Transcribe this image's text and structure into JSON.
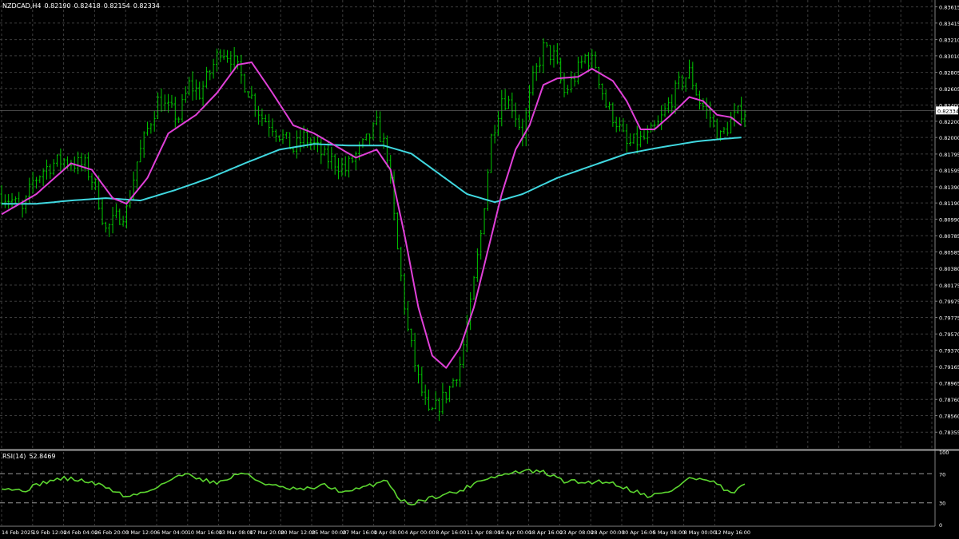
{
  "header": {
    "symbol": "NZDCAD,H4",
    "open": "0.82190",
    "high": "0.82418",
    "low": "0.82154",
    "close": "0.82334"
  },
  "rsi_header": {
    "label": "RSI(14)",
    "value": "52.8469"
  },
  "colors": {
    "background": "#000000",
    "grid": "#3c3c3c",
    "candle": "#00c800",
    "ma_fast": "#e040d8",
    "ma_slow": "#40d8e0",
    "rsi": "#5cd630",
    "text": "#ffffff",
    "current_price_bg": "#ffffff"
  },
  "chart_data": [
    {
      "type": "candlestick",
      "symbol": "NZDCAD",
      "timeframe": "H4",
      "price_ticks": [
        "0.83615",
        "0.83415",
        "0.83210",
        "0.83010",
        "0.82805",
        "0.82605",
        "0.82400",
        "0.82200",
        "0.82000",
        "0.81795",
        "0.81595",
        "0.81390",
        "0.81190",
        "0.80990",
        "0.80785",
        "0.80585",
        "0.80380",
        "0.80175",
        "0.79975",
        "0.79775",
        "0.79570",
        "0.79370",
        "0.79165",
        "0.78965",
        "0.78760",
        "0.78560",
        "0.78355"
      ],
      "current_price": "0.82334",
      "ylim": [
        0.7815,
        0.837
      ],
      "time_ticks": [
        "14 Feb 2025",
        "19 Feb 12:00",
        "24 Feb 04:00",
        "26 Feb 20:00",
        "3 Mar 12:00",
        "6 Mar 04:00",
        "10 Mar 16:00",
        "13 Mar 08:00",
        "17 Mar 20:00",
        "20 Mar 12:00",
        "25 Mar 00:00",
        "27 Mar 16:00",
        "1 Apr 08:00",
        "4 Apr 00:00",
        "8 Apr 16:00",
        "11 Apr 08:00",
        "16 Apr 00:00",
        "18 Apr 16:00",
        "23 Apr 08:00",
        "28 Apr 00:00",
        "30 Apr 16:00",
        "5 May 08:00",
        "8 May 00:00",
        "12 May 16:00"
      ],
      "close_path": [
        [
          0,
          0.813
        ],
        [
          3,
          0.8122
        ],
        [
          6,
          0.8108
        ],
        [
          9,
          0.8145
        ],
        [
          12,
          0.816
        ],
        [
          15,
          0.8168
        ],
        [
          18,
          0.8172
        ],
        [
          21,
          0.8168
        ],
        [
          24,
          0.8165
        ],
        [
          27,
          0.814
        ],
        [
          30,
          0.8085
        ],
        [
          33,
          0.81
        ],
        [
          36,
          0.811
        ],
        [
          39,
          0.817
        ],
        [
          42,
          0.821
        ],
        [
          45,
          0.8245
        ],
        [
          48,
          0.8235
        ],
        [
          51,
          0.8225
        ],
        [
          54,
          0.8265
        ],
        [
          57,
          0.8255
        ],
        [
          60,
          0.828
        ],
        [
          63,
          0.831
        ],
        [
          66,
          0.83
        ],
        [
          69,
          0.8275
        ],
        [
          72,
          0.825
        ],
        [
          75,
          0.8225
        ],
        [
          78,
          0.8215
        ],
        [
          81,
          0.82
        ],
        [
          84,
          0.8185
        ],
        [
          87,
          0.82
        ],
        [
          90,
          0.819
        ],
        [
          93,
          0.8175
        ],
        [
          96,
          0.817
        ],
        [
          99,
          0.816
        ],
        [
          102,
          0.8178
        ],
        [
          105,
          0.8195
        ],
        [
          108,
          0.8215
        ],
        [
          111,
          0.818
        ],
        [
          114,
          0.806
        ],
        [
          117,
          0.796
        ],
        [
          120,
          0.79
        ],
        [
          123,
          0.7855
        ],
        [
          126,
          0.787
        ],
        [
          129,
          0.789
        ],
        [
          132,
          0.792
        ],
        [
          135,
          0.799
        ],
        [
          138,
          0.808
        ],
        [
          141,
          0.82
        ],
        [
          144,
          0.825
        ],
        [
          147,
          0.824
        ],
        [
          150,
          0.8205
        ],
        [
          153,
          0.827
        ],
        [
          156,
          0.831
        ],
        [
          159,
          0.83
        ],
        [
          162,
          0.8255
        ],
        [
          165,
          0.8275
        ],
        [
          168,
          0.83
        ],
        [
          171,
          0.829
        ],
        [
          174,
          0.824
        ],
        [
          177,
          0.822
        ],
        [
          180,
          0.819
        ],
        [
          183,
          0.8195
        ],
        [
          186,
          0.82
        ],
        [
          189,
          0.8215
        ],
        [
          192,
          0.824
        ],
        [
          195,
          0.8265
        ],
        [
          198,
          0.828
        ],
        [
          201,
          0.8245
        ],
        [
          204,
          0.8225
        ],
        [
          207,
          0.82
        ],
        [
          210,
          0.822
        ],
        [
          213,
          0.8233
        ]
      ],
      "n_candles": 215,
      "ma_fast_path": [
        [
          0,
          0.8105
        ],
        [
          10,
          0.813
        ],
        [
          20,
          0.8168
        ],
        [
          26,
          0.816
        ],
        [
          32,
          0.8125
        ],
        [
          36,
          0.8118
        ],
        [
          42,
          0.815
        ],
        [
          48,
          0.8205
        ],
        [
          56,
          0.8228
        ],
        [
          62,
          0.8255
        ],
        [
          68,
          0.829
        ],
        [
          72,
          0.8293
        ],
        [
          78,
          0.8255
        ],
        [
          84,
          0.8215
        ],
        [
          90,
          0.8205
        ],
        [
          96,
          0.819
        ],
        [
          102,
          0.8175
        ],
        [
          108,
          0.8185
        ],
        [
          112,
          0.816
        ],
        [
          116,
          0.808
        ],
        [
          120,
          0.799
        ],
        [
          124,
          0.793
        ],
        [
          128,
          0.7915
        ],
        [
          132,
          0.794
        ],
        [
          136,
          0.799
        ],
        [
          140,
          0.806
        ],
        [
          144,
          0.813
        ],
        [
          148,
          0.8185
        ],
        [
          152,
          0.8215
        ],
        [
          156,
          0.8265
        ],
        [
          160,
          0.8273
        ],
        [
          166,
          0.8275
        ],
        [
          170,
          0.8285
        ],
        [
          176,
          0.827
        ],
        [
          180,
          0.8245
        ],
        [
          184,
          0.821
        ],
        [
          188,
          0.821
        ],
        [
          192,
          0.8225
        ],
        [
          198,
          0.825
        ],
        [
          202,
          0.8245
        ],
        [
          206,
          0.8228
        ],
        [
          210,
          0.8225
        ],
        [
          213,
          0.8215
        ]
      ],
      "ma_slow_path": [
        [
          0,
          0.8118
        ],
        [
          10,
          0.8118
        ],
        [
          20,
          0.8122
        ],
        [
          30,
          0.8125
        ],
        [
          40,
          0.8122
        ],
        [
          50,
          0.8135
        ],
        [
          60,
          0.815
        ],
        [
          70,
          0.8168
        ],
        [
          80,
          0.8185
        ],
        [
          90,
          0.8192
        ],
        [
          100,
          0.819
        ],
        [
          110,
          0.819
        ],
        [
          118,
          0.818
        ],
        [
          126,
          0.8155
        ],
        [
          134,
          0.813
        ],
        [
          142,
          0.812
        ],
        [
          150,
          0.813
        ],
        [
          160,
          0.815
        ],
        [
          170,
          0.8165
        ],
        [
          180,
          0.818
        ],
        [
          190,
          0.8188
        ],
        [
          200,
          0.8195
        ],
        [
          207,
          0.8198
        ],
        [
          213,
          0.82
        ]
      ]
    },
    {
      "type": "line",
      "name": "RSI(14)",
      "ylim": [
        0,
        100
      ],
      "levels": [
        30,
        70
      ],
      "y_ticks": [
        "100",
        "70",
        "30",
        "0"
      ],
      "path": [
        [
          0,
          52
        ],
        [
          6,
          46
        ],
        [
          12,
          58
        ],
        [
          18,
          64
        ],
        [
          24,
          60
        ],
        [
          30,
          52
        ],
        [
          36,
          38
        ],
        [
          42,
          46
        ],
        [
          48,
          60
        ],
        [
          54,
          72
        ],
        [
          57,
          62
        ],
        [
          63,
          58
        ],
        [
          69,
          72
        ],
        [
          75,
          58
        ],
        [
          81,
          50
        ],
        [
          87,
          48
        ],
        [
          93,
          54
        ],
        [
          99,
          44
        ],
        [
          105,
          52
        ],
        [
          111,
          62
        ],
        [
          114,
          38
        ],
        [
          117,
          28
        ],
        [
          120,
          32
        ],
        [
          126,
          40
        ],
        [
          132,
          46
        ],
        [
          138,
          62
        ],
        [
          144,
          68
        ],
        [
          150,
          74
        ],
        [
          156,
          72
        ],
        [
          162,
          60
        ],
        [
          168,
          58
        ],
        [
          174,
          60
        ],
        [
          180,
          50
        ],
        [
          186,
          40
        ],
        [
          192,
          44
        ],
        [
          198,
          64
        ],
        [
          204,
          60
        ],
        [
          207,
          52
        ],
        [
          210,
          42
        ],
        [
          213,
          53
        ]
      ]
    }
  ]
}
